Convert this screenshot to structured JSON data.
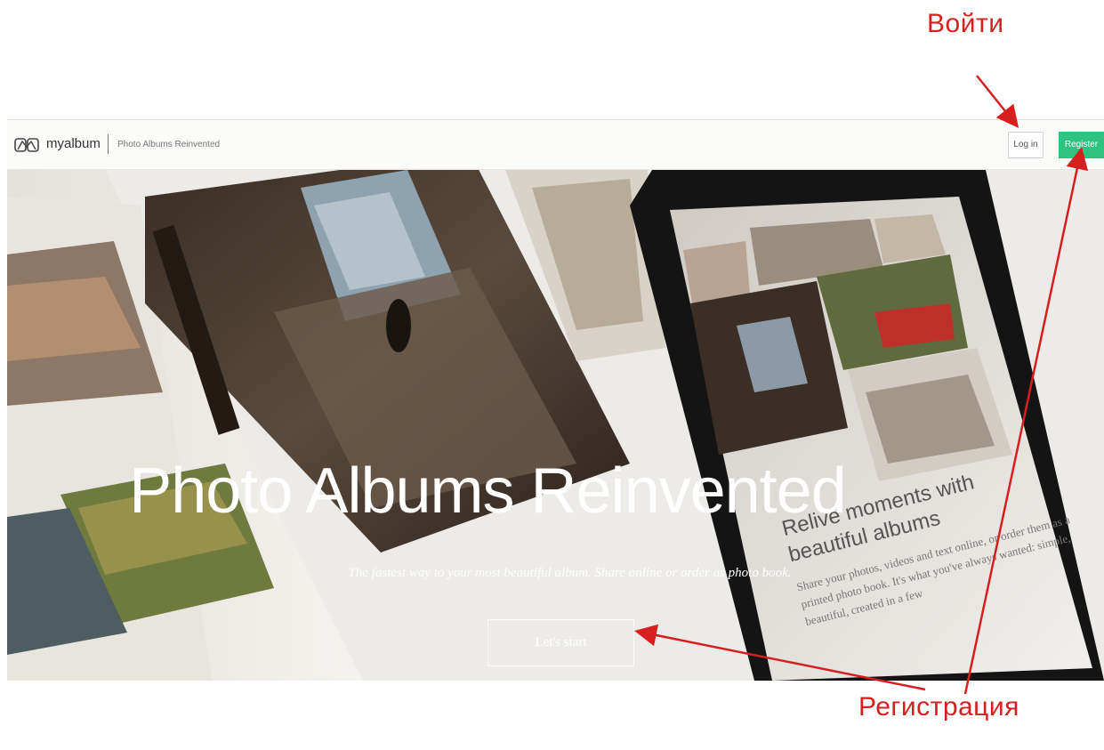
{
  "annotations": {
    "login_label": "Войти",
    "register_label": "Регистрация",
    "arrow_color": "#d61f1f"
  },
  "navbar": {
    "brand_name": "myalbum",
    "brand_tagline": "Photo Albums Reinvented",
    "login_button": "Log in",
    "register_button": "Register",
    "register_color": "#2fc380"
  },
  "hero": {
    "title": "Photo Albums Reinvented",
    "subtitle": "The fastest way to your most beautiful album. Share online or order as photo book.",
    "cta_button": "Let's start",
    "phone_heading_line1": "Relive moments with",
    "phone_heading_line2": "beautiful albums",
    "phone_body": "Share your photos, videos and text online, or order them as a printed photo book. It's what you've always wanted: simple, beautiful, created in a few"
  }
}
